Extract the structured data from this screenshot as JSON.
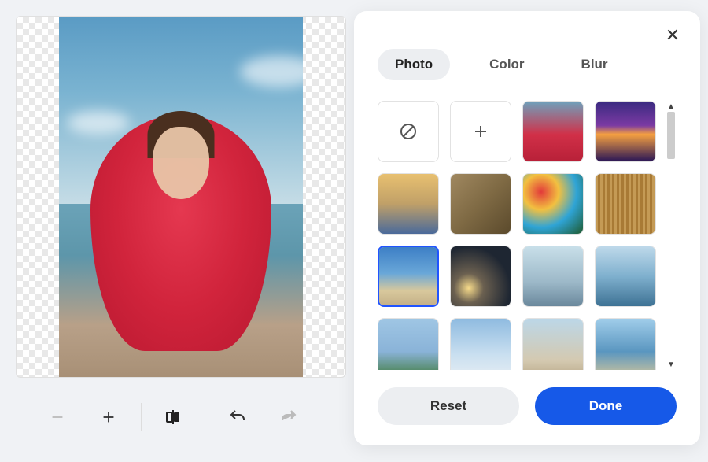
{
  "tabs": {
    "photo": "Photo",
    "color": "Color",
    "blur": "Blur"
  },
  "actions": {
    "reset": "Reset",
    "done": "Done"
  },
  "icons": {
    "close": "✕",
    "minus": "−",
    "plus": "+",
    "up": "▲",
    "down": "▼"
  },
  "thumbs": [
    {
      "kind": "none"
    },
    {
      "kind": "add"
    },
    {
      "kind": "bg",
      "name": "portrait-red-scarf",
      "gradient": "linear-gradient(180deg,#6fa0bb 0%,#d13048 55%,#b82038 100%)"
    },
    {
      "kind": "bg",
      "name": "purple-sunset-horizon",
      "gradient": "linear-gradient(180deg,#3a2a80 0%,#7b3aa3 40%,#f5a040 55%,#2a1656 100%)"
    },
    {
      "kind": "bg",
      "name": "city-sunrise",
      "gradient": "linear-gradient(180deg,#e8c070 0%,#c0a068 50%,#4a6a9a 100%)"
    },
    {
      "kind": "bg",
      "name": "cafe-street",
      "gradient": "linear-gradient(135deg,#a08860 0%,#7f6a44 50%,#5b4a2c 100%)"
    },
    {
      "kind": "bg",
      "name": "graffiti-wall",
      "gradient": "radial-gradient(circle at 30% 30%,#e23a3a 0%,#f2c040 30%,#2fa4d6 60%,#1e5a2f 100%)"
    },
    {
      "kind": "bg",
      "name": "gold-stripes",
      "gradient": "repeating-linear-gradient(90deg,#c49a55 0 3px,#a87a35 3px 6px)"
    },
    {
      "kind": "bg",
      "name": "beach-shore",
      "gradient": "linear-gradient(180deg,#3d7fc6 0%,#69a7d8 45%,#d8c89c 75%,#c4b088 100%)",
      "selected": true
    },
    {
      "kind": "bg",
      "name": "night-bokeh-city",
      "gradient": "radial-gradient(circle at 30% 70%,#f6da8a 0%,#6b6050 25%,#1e2632 70%)"
    },
    {
      "kind": "bg",
      "name": "skyline-shanghai",
      "gradient": "linear-gradient(180deg,#c8dfe9 0%,#9cb8c8 60%,#6a889c 100%)"
    },
    {
      "kind": "bg",
      "name": "skyline-chicago",
      "gradient": "linear-gradient(180deg,#bed9ea 0%,#7fb0ce 50%,#3e7294 100%)"
    },
    {
      "kind": "bg",
      "name": "mountain-green",
      "gradient": "linear-gradient(180deg,#9fc6e4 0%,#8ab3d8 55%,#3f7a3b 100%)"
    },
    {
      "kind": "bg",
      "name": "snowy-mountains",
      "gradient": "linear-gradient(180deg,#8fbbe0 0%,#c9dff0 60%,#e6edf3 100%)"
    },
    {
      "kind": "bg",
      "name": "city-domes",
      "gradient": "linear-gradient(180deg,#bcd7e8 0%,#d4c9b0 70%,#b8a888 100%)"
    },
    {
      "kind": "bg",
      "name": "coast-beach",
      "gradient": "linear-gradient(180deg,#a0cdea 0%,#5a96c0 55%,#d6c79a 100%)"
    }
  ]
}
